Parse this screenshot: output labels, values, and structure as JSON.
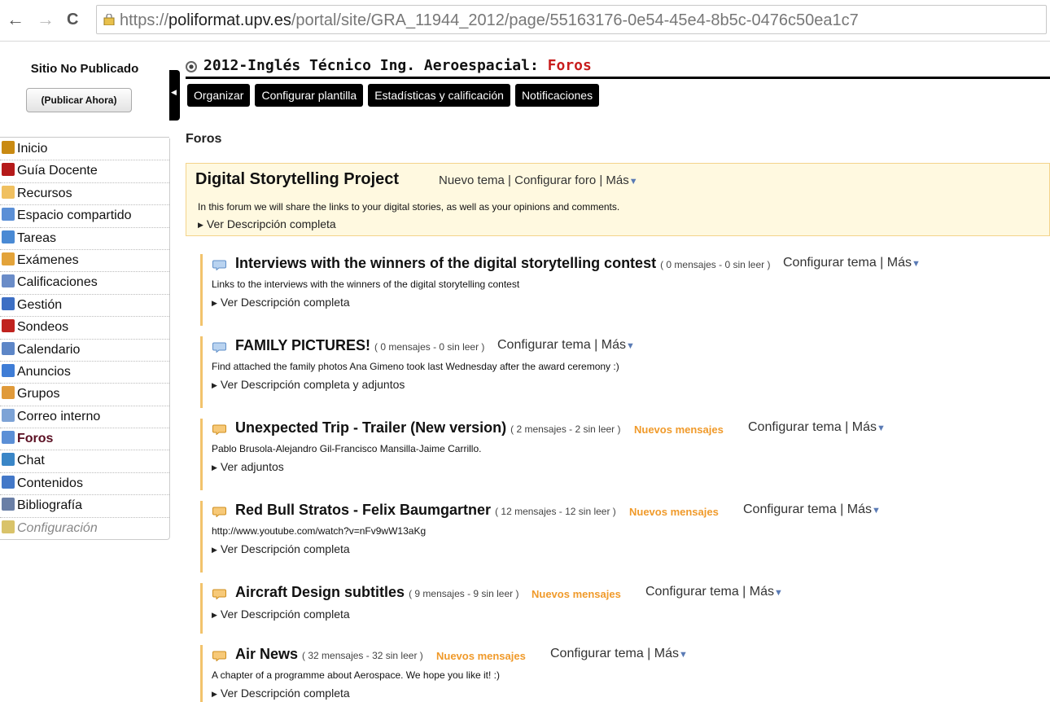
{
  "browser": {
    "url_prefix": "https://",
    "url_domain": "poliformat.upv.es",
    "url_path": "/portal/site/GRA_11944_2012/page/55163176-0e54-45e4-8b5c-0476c50ea1c7"
  },
  "sidebar": {
    "site_status": "Sitio No Publicado",
    "publish_button": "(Publicar Ahora)",
    "items": [
      {
        "label": "Inicio",
        "icon": "home-icon"
      },
      {
        "label": "Guía Docente",
        "icon": "book-icon"
      },
      {
        "label": "Recursos",
        "icon": "folder-icon"
      },
      {
        "label": "Espacio compartido",
        "icon": "shared-folder-icon"
      },
      {
        "label": "Tareas",
        "icon": "assignment-icon"
      },
      {
        "label": "Exámenes",
        "icon": "pencil-icon"
      },
      {
        "label": "Calificaciones",
        "icon": "gradebook-icon"
      },
      {
        "label": "Gestión",
        "icon": "gear-icon"
      },
      {
        "label": "Sondeos",
        "icon": "poll-icon"
      },
      {
        "label": "Calendario",
        "icon": "calendar-icon"
      },
      {
        "label": "Anuncios",
        "icon": "announcement-icon"
      },
      {
        "label": "Grupos",
        "icon": "groups-icon"
      },
      {
        "label": "Correo interno",
        "icon": "mail-bubble-icon"
      },
      {
        "label": "Foros",
        "icon": "forum-icon"
      },
      {
        "label": "Chat",
        "icon": "chat-icon"
      },
      {
        "label": "Contenidos",
        "icon": "content-icon"
      },
      {
        "label": "Bibliografía",
        "icon": "bibliography-icon"
      },
      {
        "label": "Configuración",
        "icon": "settings-icon"
      }
    ]
  },
  "header": {
    "site_title": "2012-Inglés Técnico Ing. Aeroespacial: ",
    "tool_title": "Foros"
  },
  "tabs": [
    "Organizar",
    "Configurar plantilla",
    "Estadísticas y calificación",
    "Notificaciones"
  ],
  "page_heading": "Foros",
  "forum": {
    "title": "Digital Storytelling Project",
    "actions": [
      "Nuevo tema",
      "Configurar foro",
      "Más"
    ],
    "description": "In this forum we will share the links to your digital stories, as well as your opinions and comments.",
    "more_link": "Ver Descripción completa"
  },
  "topic_actions": {
    "configure": "Configurar tema",
    "more": "Más",
    "sep": "|"
  },
  "topics": [
    {
      "title": "Interviews with the winners of the digital storytelling contest",
      "count": "( 0 mensajes - 0 sin leer )",
      "new": "",
      "description": "Links to the interviews with the winners of the digital storytelling contest",
      "more": "Ver Descripción completa"
    },
    {
      "title": "FAMILY PICTURES!",
      "count": "( 0 mensajes - 0 sin leer )",
      "new": "",
      "description": "Find attached the family photos Ana Gimeno took last Wednesday after the award ceremony :)",
      "more": "Ver Descripción completa y adjuntos"
    },
    {
      "title": "Unexpected Trip - Trailer (New version)",
      "count": "( 2 mensajes - 2 sin leer )",
      "new": "Nuevos mensajes",
      "description": "Pablo Brusola-Alejandro Gil-Francisco Mansilla-Jaime Carrillo.",
      "more": "Ver adjuntos"
    },
    {
      "title": "Red Bull Stratos - Felix Baumgartner",
      "count": "( 12 mensajes - 12 sin leer )",
      "new": "Nuevos mensajes",
      "description": "http://www.youtube.com/watch?v=nFv9wW13aKg",
      "more": "Ver Descripción completa"
    },
    {
      "title": "Aircraft Design subtitles",
      "count": "( 9 mensajes - 9 sin leer )",
      "new": "Nuevos mensajes",
      "description": "",
      "more": "Ver Descripción completa"
    },
    {
      "title": "Air News",
      "count": "( 32 mensajes - 32 sin leer )",
      "new": "Nuevos mensajes",
      "description": "A chapter of a programme about Aerospace. We hope you like it! :)",
      "more": "Ver Descripción completa"
    }
  ]
}
